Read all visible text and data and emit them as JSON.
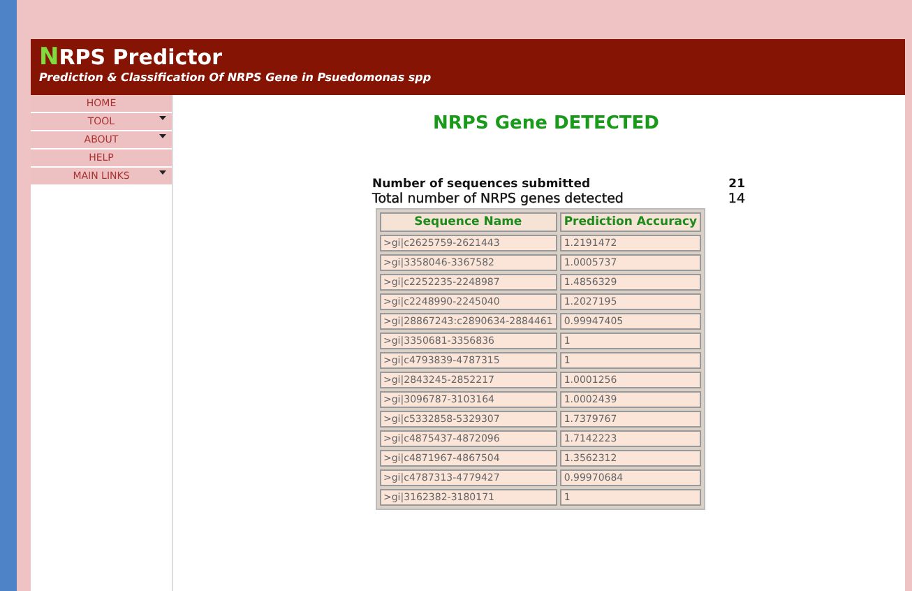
{
  "header": {
    "logo_initial": "N",
    "logo_rest": "RPS Predictor",
    "tagline": "Prediction & Classification Of NRPS Gene in Psuedomonas spp"
  },
  "menu": [
    {
      "label": "HOME",
      "has_submenu": false
    },
    {
      "label": "TOOL",
      "has_submenu": true
    },
    {
      "label": "ABOUT",
      "has_submenu": true
    },
    {
      "label": "HELP",
      "has_submenu": false
    },
    {
      "label": "MAIN LINKS",
      "has_submenu": true
    }
  ],
  "result": {
    "heading": "NRPS Gene DETECTED",
    "summary": [
      {
        "label": "Number of sequences submitted",
        "value": "21"
      },
      {
        "label": "Total number of NRPS genes detected",
        "value": "14"
      }
    ],
    "table": {
      "columns": [
        "Sequence Name",
        "Prediction Accuracy"
      ],
      "rows": [
        [
          ">gi|c2625759-2621443",
          "1.2191472"
        ],
        [
          ">gi|3358046-3367582",
          "1.0005737"
        ],
        [
          ">gi|c2252235-2248987",
          "1.4856329"
        ],
        [
          ">gi|c2248990-2245040",
          "1.2027195"
        ],
        [
          ">gi|28867243:c2890634-2884461",
          "0.99947405"
        ],
        [
          ">gi|3350681-3356836",
          "1"
        ],
        [
          ">gi|c4793839-4787315",
          "1"
        ],
        [
          ">gi|2843245-2852217",
          "1.0001256"
        ],
        [
          ">gi|3096787-3103164",
          "1.0002439"
        ],
        [
          ">gi|c5332858-5329307",
          "1.7379767"
        ],
        [
          ">gi|c4875437-4872096",
          "1.7142223"
        ],
        [
          ">gi|c4871967-4867504",
          "1.3562312"
        ],
        [
          ">gi|c4787313-4779427",
          "0.99970684"
        ],
        [
          ">gi|3162382-3180171",
          "1"
        ]
      ]
    }
  }
}
